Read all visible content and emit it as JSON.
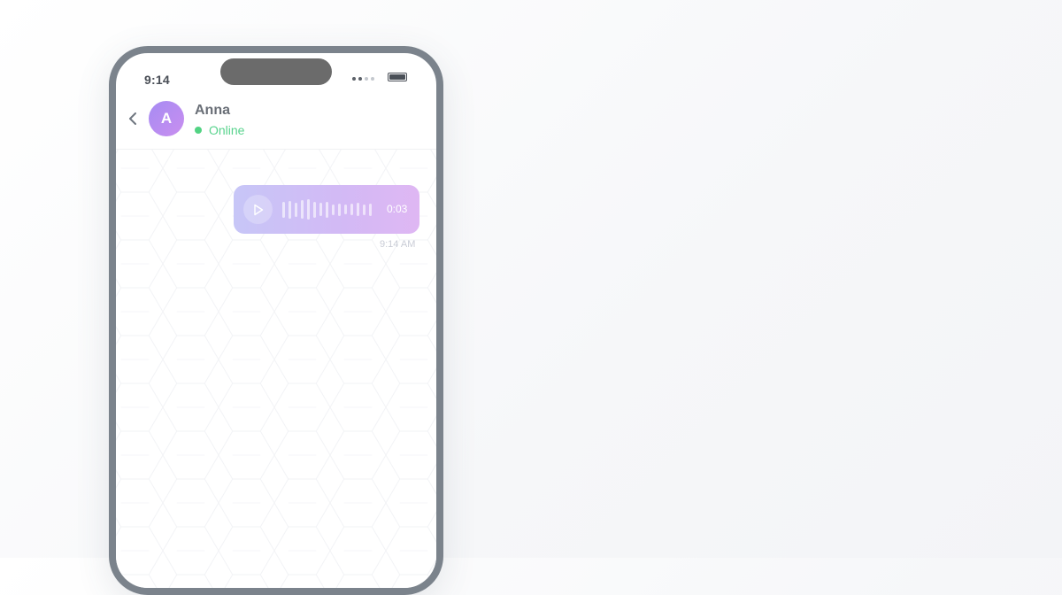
{
  "status_bar": {
    "time": "9:14"
  },
  "chat": {
    "contact_name": "Anna",
    "avatar_initial": "A",
    "presence": "Online",
    "back_icon": "chevron-left-icon"
  },
  "messages": [
    {
      "type": "voice",
      "duration": "0:03",
      "time": "9:14 AM",
      "played_fraction": 0
    }
  ],
  "colors": {
    "accent_from": "#c7c6f7",
    "accent_to": "#dfb7f3",
    "online": "#52d383"
  }
}
